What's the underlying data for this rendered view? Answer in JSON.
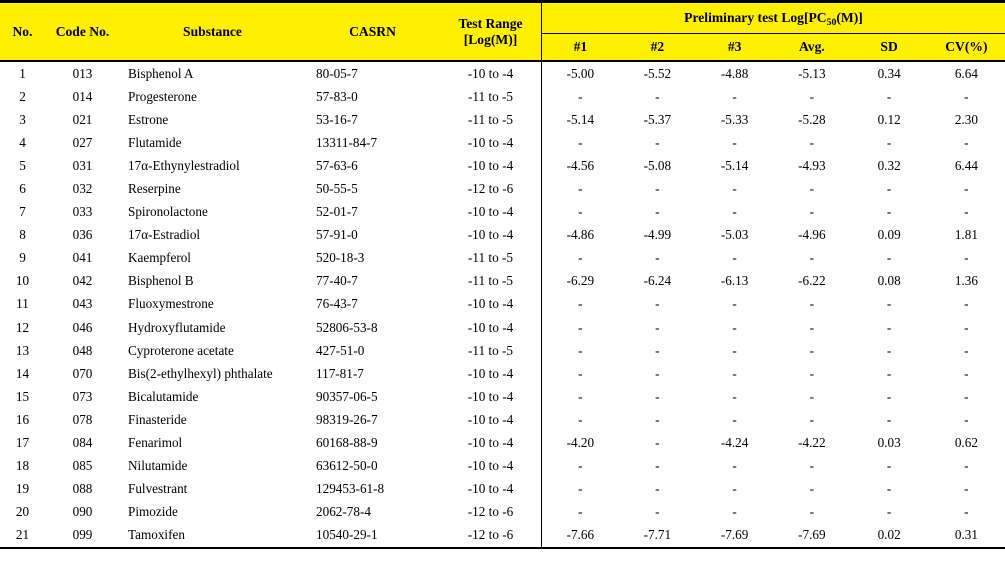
{
  "table": {
    "columns": {
      "no": "No.",
      "code": "Code No.",
      "substance": "Substance",
      "casrn": "CASRN",
      "test_range": "Test Range [Log(M)]",
      "group_title_pre": "Preliminary test Log[PC",
      "group_title_sub": "50",
      "group_title_post": "(M)]",
      "rep1": "#1",
      "rep2": "#2",
      "rep3": "#3",
      "avg": "Avg.",
      "sd": "SD",
      "cv": "CV(%)"
    },
    "rows": [
      {
        "no": "1",
        "code": "013",
        "substance": "Bisphenol A",
        "casrn": "80-05-7",
        "range": "-10 to -4",
        "r1": "-5.00",
        "r2": "-5.52",
        "r3": "-4.88",
        "avg": "-5.13",
        "sd": "0.34",
        "cv": "6.64"
      },
      {
        "no": "2",
        "code": "014",
        "substance": "Progesterone",
        "casrn": "57-83-0",
        "range": "-11 to -5",
        "r1": "-",
        "r2": "-",
        "r3": "-",
        "avg": "-",
        "sd": "-",
        "cv": "-"
      },
      {
        "no": "3",
        "code": "021",
        "substance": "Estrone",
        "casrn": "53-16-7",
        "range": "-11 to -5",
        "r1": "-5.14",
        "r2": "-5.37",
        "r3": "-5.33",
        "avg": "-5.28",
        "sd": "0.12",
        "cv": "2.30"
      },
      {
        "no": "4",
        "code": "027",
        "substance": "Flutamide",
        "casrn": "13311-84-7",
        "range": "-10 to -4",
        "r1": "-",
        "r2": "-",
        "r3": "-",
        "avg": "-",
        "sd": "-",
        "cv": "-"
      },
      {
        "no": "5",
        "code": "031",
        "substance": "17α-Ethynylestradiol",
        "casrn": "57-63-6",
        "range": "-10 to -4",
        "r1": "-4.56",
        "r2": "-5.08",
        "r3": "-5.14",
        "avg": "-4.93",
        "sd": "0.32",
        "cv": "6.44"
      },
      {
        "no": "6",
        "code": "032",
        "substance": "Reserpine",
        "casrn": "50-55-5",
        "range": "-12 to -6",
        "r1": "-",
        "r2": "-",
        "r3": "-",
        "avg": "-",
        "sd": "-",
        "cv": "-"
      },
      {
        "no": "7",
        "code": "033",
        "substance": "Spironolactone",
        "casrn": "52-01-7",
        "range": "-10 to -4",
        "r1": "-",
        "r2": "-",
        "r3": "-",
        "avg": "-",
        "sd": "-",
        "cv": "-"
      },
      {
        "no": "8",
        "code": "036",
        "substance": "17α-Estradiol",
        "casrn": "57-91-0",
        "range": "-10 to -4",
        "r1": "-4.86",
        "r2": "-4.99",
        "r3": "-5.03",
        "avg": "-4.96",
        "sd": "0.09",
        "cv": "1.81"
      },
      {
        "no": "9",
        "code": "041",
        "substance": "Kaempferol",
        "casrn": "520-18-3",
        "range": "-11 to -5",
        "r1": "-",
        "r2": "-",
        "r3": "-",
        "avg": "-",
        "sd": "-",
        "cv": "-"
      },
      {
        "no": "10",
        "code": "042",
        "substance": "Bisphenol B",
        "casrn": "77-40-7",
        "range": "-11 to -5",
        "r1": "-6.29",
        "r2": "-6.24",
        "r3": "-6.13",
        "avg": "-6.22",
        "sd": "0.08",
        "cv": "1.36"
      },
      {
        "no": "11",
        "code": "043",
        "substance": "Fluoxymestrone",
        "casrn": "76-43-7",
        "range": "-10 to -4",
        "r1": "-",
        "r2": "-",
        "r3": "-",
        "avg": "-",
        "sd": "-",
        "cv": "-"
      },
      {
        "no": "12",
        "code": "046",
        "substance": "Hydroxyflutamide",
        "casrn": "52806-53-8",
        "range": "-10 to -4",
        "r1": "-",
        "r2": "-",
        "r3": "-",
        "avg": "-",
        "sd": "-",
        "cv": "-"
      },
      {
        "no": "13",
        "code": "048",
        "substance": "Cyproterone acetate",
        "casrn": "427-51-0",
        "range": "-11 to -5",
        "r1": "-",
        "r2": "-",
        "r3": "-",
        "avg": "-",
        "sd": "-",
        "cv": "-"
      },
      {
        "no": "14",
        "code": "070",
        "substance": "Bis(2-ethylhexyl) phthalate",
        "casrn": "117-81-7",
        "range": "-10 to -4",
        "r1": "-",
        "r2": "-",
        "r3": "-",
        "avg": "-",
        "sd": "-",
        "cv": "-"
      },
      {
        "no": "15",
        "code": "073",
        "substance": "Bicalutamide",
        "casrn": "90357-06-5",
        "range": "-10 to -4",
        "r1": "-",
        "r2": "-",
        "r3": "-",
        "avg": "-",
        "sd": "-",
        "cv": "-"
      },
      {
        "no": "16",
        "code": "078",
        "substance": "Finasteride",
        "casrn": "98319-26-7",
        "range": "-10 to -4",
        "r1": "-",
        "r2": "-",
        "r3": "-",
        "avg": "-",
        "sd": "-",
        "cv": "-"
      },
      {
        "no": "17",
        "code": "084",
        "substance": "Fenarimol",
        "casrn": "60168-88-9",
        "range": "-10 to -4",
        "r1": "-4.20",
        "r2": "-",
        "r3": "-4.24",
        "avg": "-4.22",
        "sd": "0.03",
        "cv": "0.62"
      },
      {
        "no": "18",
        "code": "085",
        "substance": "Nilutamide",
        "casrn": "63612-50-0",
        "range": "-10 to -4",
        "r1": "-",
        "r2": "-",
        "r3": "-",
        "avg": "-",
        "sd": "-",
        "cv": "-"
      },
      {
        "no": "19",
        "code": "088",
        "substance": "Fulvestrant",
        "casrn": "129453-61-8",
        "range": "-10 to -4",
        "r1": "-",
        "r2": "-",
        "r3": "-",
        "avg": "-",
        "sd": "-",
        "cv": "-"
      },
      {
        "no": "20",
        "code": "090",
        "substance": "Pimozide",
        "casrn": "2062-78-4",
        "range": "-12 to -6",
        "r1": "-",
        "r2": "-",
        "r3": "-",
        "avg": "-",
        "sd": "-",
        "cv": "-"
      },
      {
        "no": "21",
        "code": "099",
        "substance": "Tamoxifen",
        "casrn": "10540-29-1",
        "range": "-12 to -6",
        "r1": "-7.66",
        "r2": "-7.71",
        "r3": "-7.69",
        "avg": "-7.69",
        "sd": "0.02",
        "cv": "0.31"
      }
    ]
  },
  "colors": {
    "header_background": "#fff000",
    "rule": "#000000",
    "text": "#000000",
    "body_background": "#ffffff"
  }
}
